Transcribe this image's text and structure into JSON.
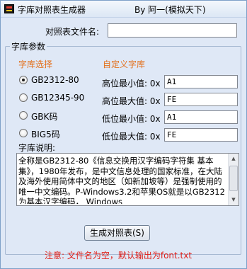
{
  "window": {
    "title": "字库对照表生成器",
    "author": "By 阿一(模拟天下)"
  },
  "file_name": {
    "label": "对照表文件名:",
    "value": ""
  },
  "group": {
    "title": "字库参数",
    "charset_header": "字库选择",
    "custom_header": "自定义字库"
  },
  "charsets": [
    {
      "label": "GB2312-80",
      "selected": true
    },
    {
      "label": "GB12345-90",
      "selected": false
    },
    {
      "label": "GBK码",
      "selected": false
    },
    {
      "label": "BIG5码",
      "selected": false
    }
  ],
  "custom_fields": [
    {
      "label": "高位最小值: 0x",
      "value": "A1"
    },
    {
      "label": "高位最大值: 0x",
      "value": "FE"
    },
    {
      "label": "低位最小值: 0x",
      "value": "A1"
    },
    {
      "label": "低位最大值: 0x",
      "value": "FE"
    }
  ],
  "description": {
    "label": "字库说明:",
    "text": "全称是GB2312-80《信息交换用汉字编码字符集 基本集》，1980年发布，是中文信息处理的国家标准，在大陆及海外使用简体中文的地区（如新加坡等）是强制使用的唯一中文编码。P-Windows3.2和苹果OS就是以GB2312为基本汉字编码， Windows"
  },
  "generate_button": {
    "label": "生成对照表(S)"
  },
  "notice": "注意: 文件名为空，默认输出为font.txt",
  "colors": {
    "accent_orange": "#e3701c",
    "warning_red": "#e0201a"
  }
}
